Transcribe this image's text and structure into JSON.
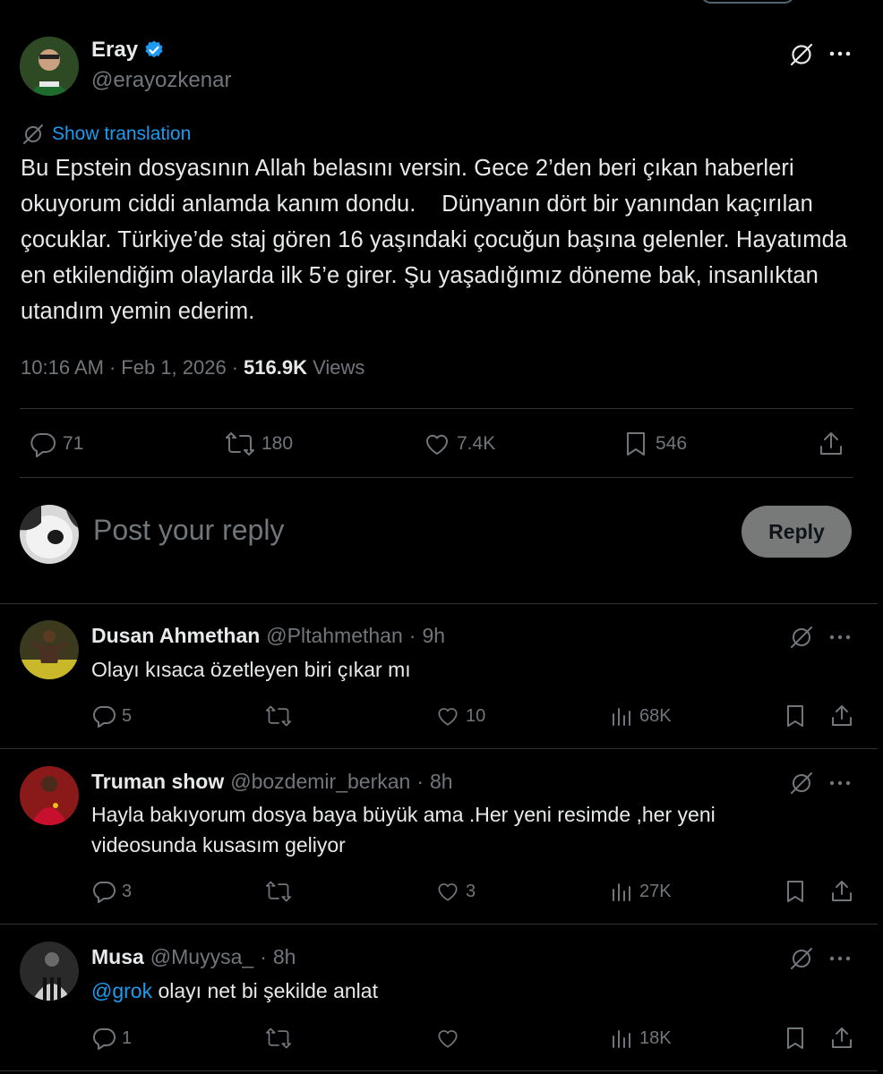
{
  "tweet": {
    "author_name": "Eray",
    "author_handle": "@erayozkenar",
    "show_translation": "Show translation",
    "text": "Bu Epstein dosyasının Allah belasını versin. Gece 2’den beri çıkan haberleri okuyorum ciddi anlamda kanım dondu.    Dünyanın dört bir yanından kaçırılan çocuklar. Türkiye’de staj gören 16 yaşındaki çocuğun başına gelenler. Hayatımda en etkilendiğim olaylarda ilk 5’e girer. Şu yaşadığımız döneme bak, insanlıktan utandım yemin ederim.",
    "time": "10:16 AM",
    "date": "Feb 1, 2026",
    "views_count": "516.9K",
    "views_label": "Views",
    "replies": "71",
    "reposts": "180",
    "likes": "7.4K",
    "bookmarks": "546"
  },
  "compose": {
    "placeholder": "Post your reply",
    "reply_button": "Reply"
  },
  "replies": [
    {
      "name": "Dusan Ahmethan",
      "handle": "@Pltahmethan",
      "time": "9h",
      "text": "Olayı kısaca özetleyen biri çıkar mı",
      "replies": "5",
      "reposts": "",
      "likes": "10",
      "views": "68K"
    },
    {
      "name": "Truman show",
      "handle": "@bozdemir_berkan",
      "time": "8h",
      "text": "Hayla bakıyorum  dosya baya büyük ama .Her yeni resimde ,her yeni videosunda kusasım geliyor",
      "replies": "3",
      "reposts": "",
      "likes": "3",
      "views": "27K"
    },
    {
      "name": "Musa",
      "handle": "@Muyysa_",
      "time": "8h",
      "mention": "@grok",
      "text": " olayı net bi şekilde anlat",
      "replies": "1",
      "reposts": "",
      "likes": "",
      "views": "18K"
    }
  ],
  "separator": "·"
}
